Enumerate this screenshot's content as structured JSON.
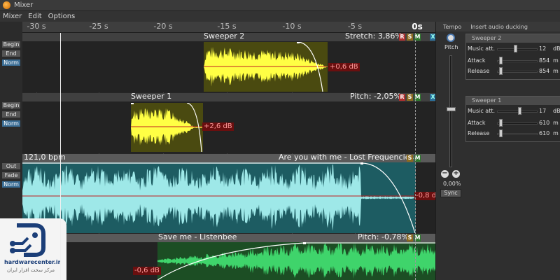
{
  "window": {
    "title": "Mixer"
  },
  "menu": [
    "Mixer",
    "Edit",
    "Options"
  ],
  "timeline": {
    "ticks": [
      {
        "label": "-30 s",
        "pos": 0.034
      },
      {
        "label": "-25 s",
        "pos": 0.185
      },
      {
        "label": "-20 s",
        "pos": 0.34
      },
      {
        "label": "-15 s",
        "pos": 0.495
      },
      {
        "label": "-10 s",
        "pos": 0.652
      },
      {
        "label": "-5 s",
        "pos": 0.805
      },
      {
        "label": "0s",
        "pos": 0.955
      }
    ]
  },
  "tracks": {
    "sweeper2": {
      "title": "Sweeper 2",
      "info": "Stretch: 3,86%",
      "gain": "+0,6 dB",
      "buttons": [
        "Begin",
        "End",
        "Norm"
      ],
      "icons": [
        "R",
        "S",
        "M",
        "X"
      ],
      "wave_color": "#ffff44",
      "clip_bg": "#4a4a10"
    },
    "sweeper1": {
      "title": "Sweeper 1",
      "info": "Pitch: -2,05%",
      "gain": "+2,6 dB",
      "buttons": [
        "Begin",
        "End",
        "Norm"
      ],
      "icons": [
        "R",
        "S",
        "M",
        "X"
      ],
      "wave_color": "#ffff44",
      "clip_bg": "#4a4a10"
    },
    "song1": {
      "bpm": "121,0 bpm",
      "title": "Are you with me - Lost Frequencies",
      "gain": "-0,8 dB",
      "buttons": [
        "Out",
        "Fade",
        "Norm"
      ],
      "icons": [
        "S",
        "M"
      ],
      "wave_color": "#9ee8e8",
      "clip_bg": "#1d5c62"
    },
    "song2": {
      "bpm": "bpm",
      "title": "Save me - Listenbee",
      "info": "Pitch: -0,78%",
      "gain": "-0,6 dB",
      "buttons": [
        "Out"
      ],
      "icons": [
        "S",
        "M"
      ],
      "wave_color": "#3fd46b",
      "clip_bg": "#1c4e24"
    }
  },
  "panel": {
    "tabs": [
      "Tempo",
      "Insert audio ducking"
    ],
    "pitch_label": "Pitch",
    "pitch_value": "0,00%",
    "sync_label": "Sync",
    "ducking": [
      {
        "name": "Sweeper 2",
        "rows": [
          {
            "label": "Music att.",
            "value": "12",
            "unit": "dB",
            "level": 0.45
          },
          {
            "label": "Attack",
            "value": "854",
            "unit": "m",
            "level": 0.05
          },
          {
            "label": "Release",
            "value": "854",
            "unit": "m",
            "level": 0.05
          }
        ]
      },
      {
        "name": "Sweeper 1",
        "rows": [
          {
            "label": "Music att.",
            "value": "17",
            "unit": "dB",
            "level": 0.55
          },
          {
            "label": "Attack",
            "value": "610",
            "unit": "m",
            "level": 0.05
          },
          {
            "label": "Release",
            "value": "610",
            "unit": "m",
            "level": 0.05
          }
        ]
      }
    ]
  },
  "watermark": {
    "site": "hardwarecenter.ir",
    "tagline": "مرکز سخت افزار ایران"
  }
}
